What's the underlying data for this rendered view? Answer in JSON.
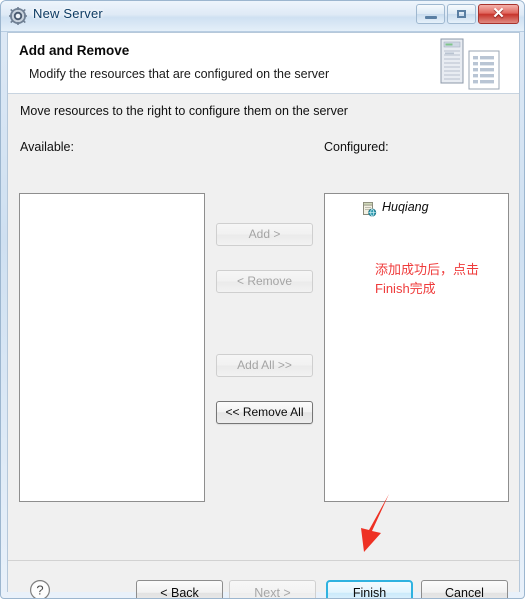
{
  "window": {
    "title": "New Server",
    "icon": "server-gear-icon",
    "controls": {
      "minimize": "minimize-icon",
      "maximize": "restore-icon",
      "close": "✕"
    }
  },
  "header": {
    "title": "Add and Remove",
    "subtitle": "Modify the resources that are configured on the server",
    "art": "server-and-document-illustration"
  },
  "body": {
    "instruction": "Move resources to the right to configure them on the server",
    "available": {
      "label": "Available:",
      "items": []
    },
    "configured": {
      "label": "Configured:",
      "items": [
        {
          "name": "Huqiang",
          "icon": "web-project-icon"
        }
      ]
    },
    "annotation": {
      "text": "添加成功后，点击\nFinish完成",
      "color": "#ef3b3b"
    },
    "transfer_buttons": [
      {
        "label": "Add >",
        "enabled": false
      },
      {
        "label": "< Remove",
        "enabled": false
      },
      {
        "label": "Add All >>",
        "enabled": false
      },
      {
        "label": "<< Remove All",
        "enabled": true
      }
    ]
  },
  "footer": {
    "help": "?",
    "buttons": [
      {
        "label": "< Back",
        "state": "normal"
      },
      {
        "label": "Next >",
        "state": "disabled"
      },
      {
        "label": "Finish",
        "state": "default"
      },
      {
        "label": "Cancel",
        "state": "normal"
      }
    ]
  },
  "overlay": {
    "arrow": {
      "color": "#ee3124",
      "points_to": "finish-button"
    }
  }
}
